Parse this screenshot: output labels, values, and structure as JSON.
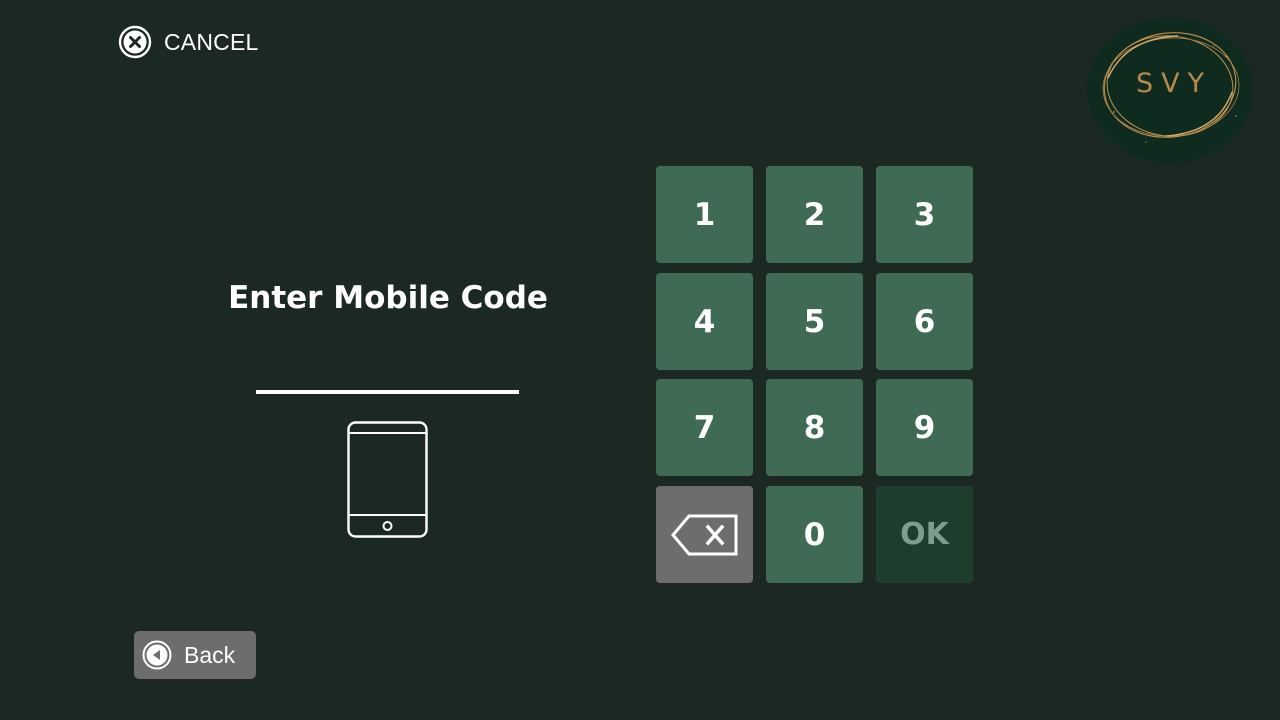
{
  "header": {
    "cancel_label": "CANCEL",
    "cancel_icon": "close-circle-icon"
  },
  "logo": {
    "text": "SVY"
  },
  "prompt": {
    "title": "Enter Mobile Code",
    "code_value": "",
    "device_icon": "tablet-icon"
  },
  "keypad": {
    "keys": [
      "1",
      "2",
      "3",
      "4",
      "5",
      "6",
      "7",
      "8",
      "9",
      "",
      "0",
      "OK"
    ],
    "delete_icon": "backspace-icon",
    "ok_label": "OK"
  },
  "footer": {
    "back_label": "Back",
    "back_icon": "back-arrow-icon"
  },
  "colors": {
    "background": "#1c2923",
    "key": "#3f6b54",
    "key_disabled": "#1d3e2c",
    "delete_key": "#6d6d6d",
    "back_button": "#6d6d6d",
    "logo_gold": "#b78a4a"
  }
}
